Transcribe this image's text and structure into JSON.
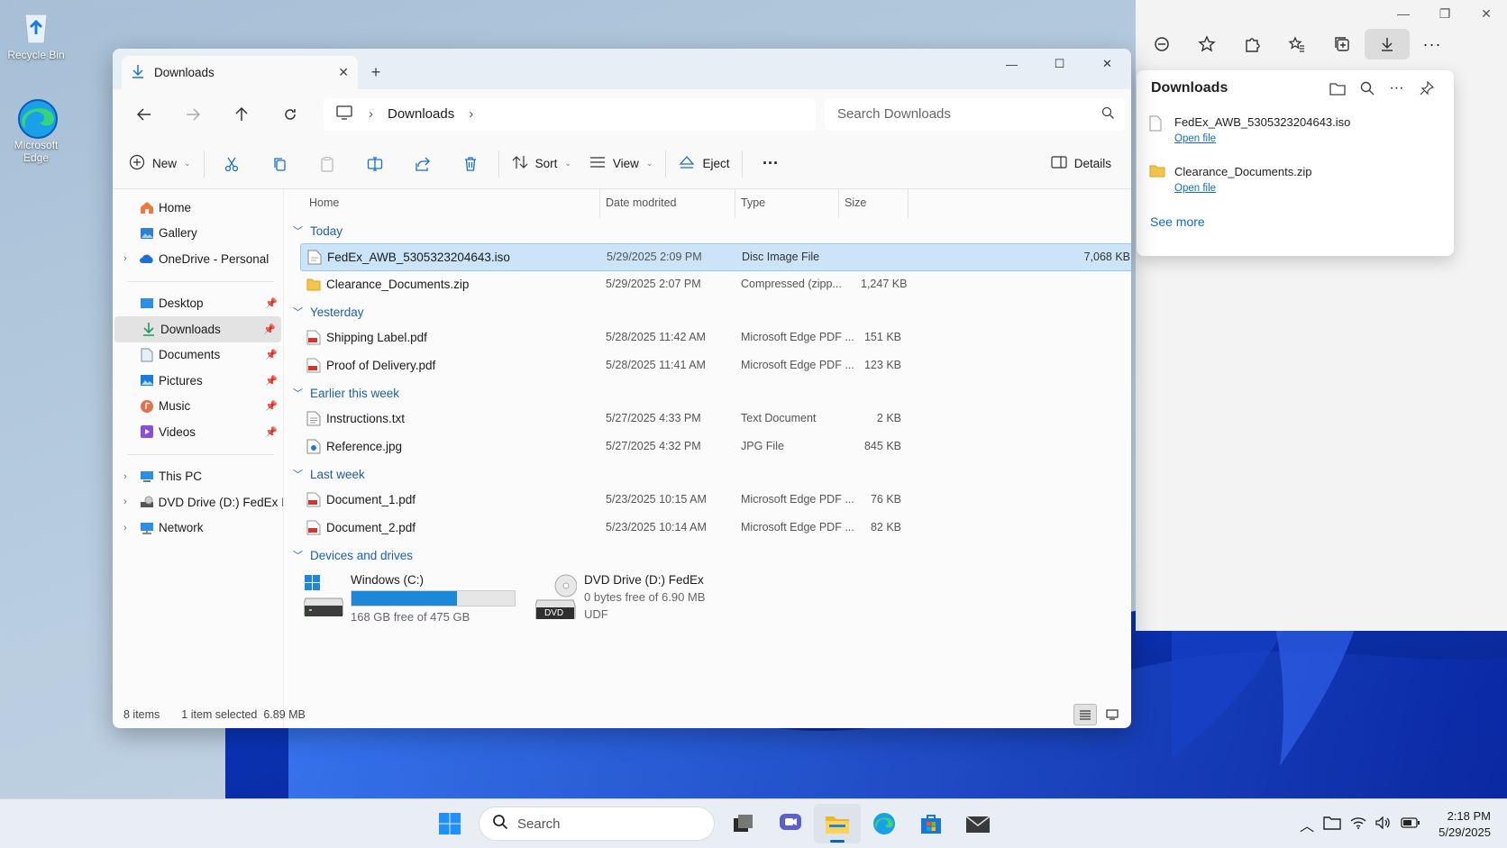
{
  "desktop": {
    "icons": [
      {
        "label": "Recycle Bin"
      },
      {
        "label": "Microsoft Edge"
      }
    ]
  },
  "edge": {
    "downloads_panel": {
      "title": "Downloads",
      "items": [
        {
          "name": "FedEx_AWB_5305323204643.iso",
          "link": "Open file",
          "icon": "file-icon"
        },
        {
          "name": "Clearance_Documents.zip",
          "link": "Open file",
          "icon": "zip-folder-icon"
        }
      ],
      "see_more": "See more"
    }
  },
  "explorer": {
    "tab_title": "Downloads",
    "breadcrumb": "Downloads",
    "search_placeholder": "Search Downloads",
    "toolbar": {
      "new": "New",
      "sort": "Sort",
      "view": "View",
      "eject": "Eject",
      "details": "Details"
    },
    "sidebar": {
      "home": "Home",
      "gallery": "Gallery",
      "onedrive": "OneDrive - Personal",
      "desktop": "Desktop",
      "downloads": "Downloads",
      "documents": "Documents",
      "pictures": "Pictures",
      "music": "Music",
      "videos": "Videos",
      "thispc": "This PC",
      "dvd": "DVD Drive (D:) FedEx I",
      "network": "Network"
    },
    "columns": {
      "name": "Home",
      "date": "Date modrited",
      "type": "Type",
      "size": "Size"
    },
    "groups": {
      "today": {
        "label": "Today",
        "rows": [
          {
            "name": "FedEx_AWB_5305323204643.iso",
            "date": "5/29/2025 2:09 PM",
            "type": "Disc Image File",
            "size": "7,068 KB"
          },
          {
            "name": "Clearance_Documents.zip",
            "date": "5/29/2025 2:07 PM",
            "type": "Compressed (zipp...",
            "size": "1,247 KB"
          }
        ]
      },
      "yesterday": {
        "label": "Yesterday",
        "rows": [
          {
            "name": "Shipping Label.pdf",
            "date": "5/28/2025 11:42 AM",
            "type": "Microsoft Edge PDF ...",
            "size": "151 KB"
          },
          {
            "name": "Proof of Delivery.pdf",
            "date": "5/28/2025 11:41 AM",
            "type": "Microsoft Edge PDF ...",
            "size": "123 KB"
          }
        ]
      },
      "earlier": {
        "label": "Earlier this week",
        "rows": [
          {
            "name": "Instructions.txt",
            "date": "5/27/2025 4:33 PM",
            "type": "Text Document",
            "size": "2 KB"
          },
          {
            "name": "Reference.jpg",
            "date": "5/27/2025 4:32 PM",
            "type": "JPG File",
            "size": "845 KB"
          }
        ]
      },
      "lastweek": {
        "label": "Last week",
        "rows": [
          {
            "name": "Document_1.pdf",
            "date": "5/23/2025 10:15 AM",
            "type": "Microsoft Edge PDF ...",
            "size": "76 KB"
          },
          {
            "name": "Document_2.pdf",
            "date": "5/23/2025 10:14 AM",
            "type": "Microsoft Edge PDF ...",
            "size": "82 KB"
          }
        ]
      },
      "devices": {
        "label": "Devices and drives",
        "drives": [
          {
            "name": "Windows (C:)",
            "free": "168 GB free of 475 GB",
            "used_fraction": 0.646
          },
          {
            "name": "DVD Drive (D:) FedEx",
            "free": "0 bytes free of 6.90 MB",
            "fs": "UDF",
            "badge": "DVD"
          }
        ]
      }
    },
    "status": {
      "count": "8 items",
      "selection": "1 item selected  6.89 MB"
    }
  },
  "taskbar": {
    "search": "Search",
    "time": "2:18 PM",
    "date": "5/29/2025"
  },
  "colors": {
    "accent": "#0067c0",
    "selection": "#cce4f7",
    "group": "#1d5fa8"
  }
}
